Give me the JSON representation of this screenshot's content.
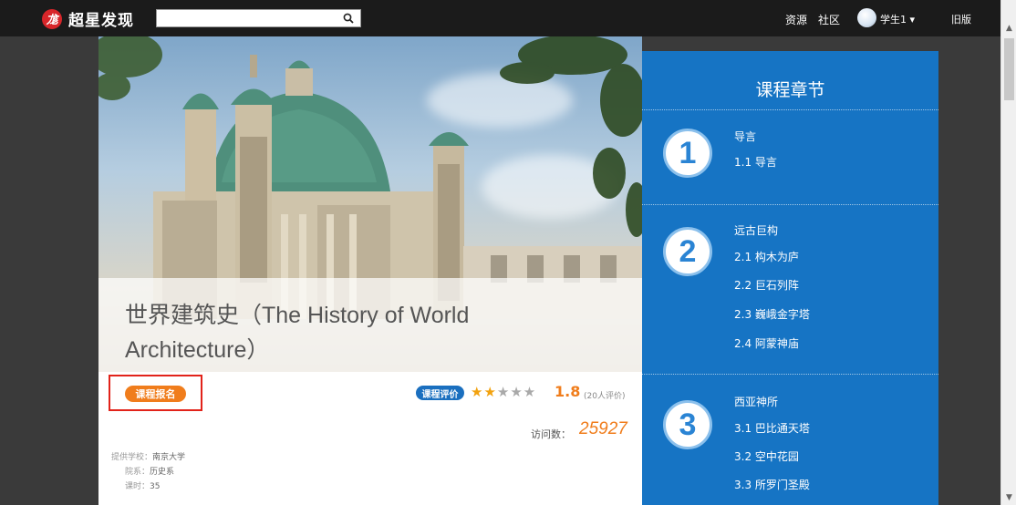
{
  "header": {
    "logo_mark": "尨",
    "logo_text": "超星发现",
    "search_placeholder": "",
    "nav": [
      "资源",
      "社区"
    ],
    "user": "学生1",
    "user_caret": "▾",
    "old_version": "旧版"
  },
  "course": {
    "title": "世界建筑史（The History of World Architecture）",
    "enroll_label": "课程报名",
    "eval_label": "课程评价",
    "stars_on": "★★",
    "stars_off": "★★★",
    "rating": "1.8",
    "rating_count": "(20人评价)",
    "visits_label": "访问数：",
    "visits": "25927",
    "school_label": "提供学校：",
    "school": "南京大学",
    "dept_label": "院系：",
    "dept": "历史系",
    "hours_label": "课时：",
    "hours": "35"
  },
  "chapters": {
    "title": "课程章节",
    "list": [
      {
        "num": "1",
        "name": "导言",
        "items": [
          "1.1  导言"
        ]
      },
      {
        "num": "2",
        "name": "远古巨构",
        "items": [
          "2.1  构木为庐",
          "2.2  巨石列阵",
          "2.3  巍峨金字塔",
          "2.4  阿蒙神庙"
        ]
      },
      {
        "num": "3",
        "name": "西亚神所",
        "items": [
          "3.1  巴比通天塔",
          "3.2  空中花园",
          "3.3  所罗门圣殿"
        ]
      }
    ]
  },
  "colors": {
    "topbar": "#1b1b1b",
    "panel_blue": "#1674c4",
    "orange": "#f07d1c",
    "highlight_red": "#e2231a"
  }
}
